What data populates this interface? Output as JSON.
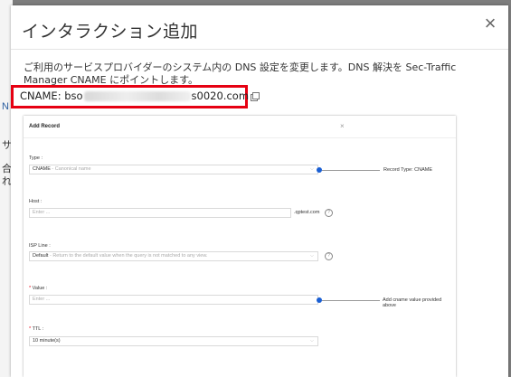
{
  "dialog": {
    "title": "インタラクション追加",
    "close_glyph": "×",
    "description": "ご利用のサービスプロバイダーのシステム内の DNS 設定を変更します。DNS 解決を Sec-Traffic Manager CNAME にポイントします。",
    "cname": {
      "prefix": "CNAME: bso",
      "suffix": "s0020.com"
    }
  },
  "background": {
    "chars": [
      "N",
      "サ",
      "合",
      "れ"
    ]
  },
  "embedded": {
    "title": "Add Record",
    "close_glyph": "×",
    "type": {
      "label": "Type :",
      "value": "CNAME",
      "value_hint": "- Canonical name",
      "note": "Record Type:   CNAME"
    },
    "host": {
      "label": "Host :",
      "placeholder": "Enter ...",
      "suffix": ".qptest.com",
      "help": "?"
    },
    "isp_line": {
      "label": "ISP Line :",
      "value": "Default",
      "value_hint": "- Return to the default value when the query is not matched to any view.",
      "help": "?"
    },
    "value": {
      "label": "Value :",
      "placeholder": "Enter ...",
      "note": "Add cname value provided above"
    },
    "ttl": {
      "label": "TTL :",
      "value": "10 minute(s)"
    },
    "required_mark": "*",
    "chevron": "⌵"
  },
  "colors": {
    "highlight": "#e60012",
    "accent": "#1a5fd4"
  }
}
